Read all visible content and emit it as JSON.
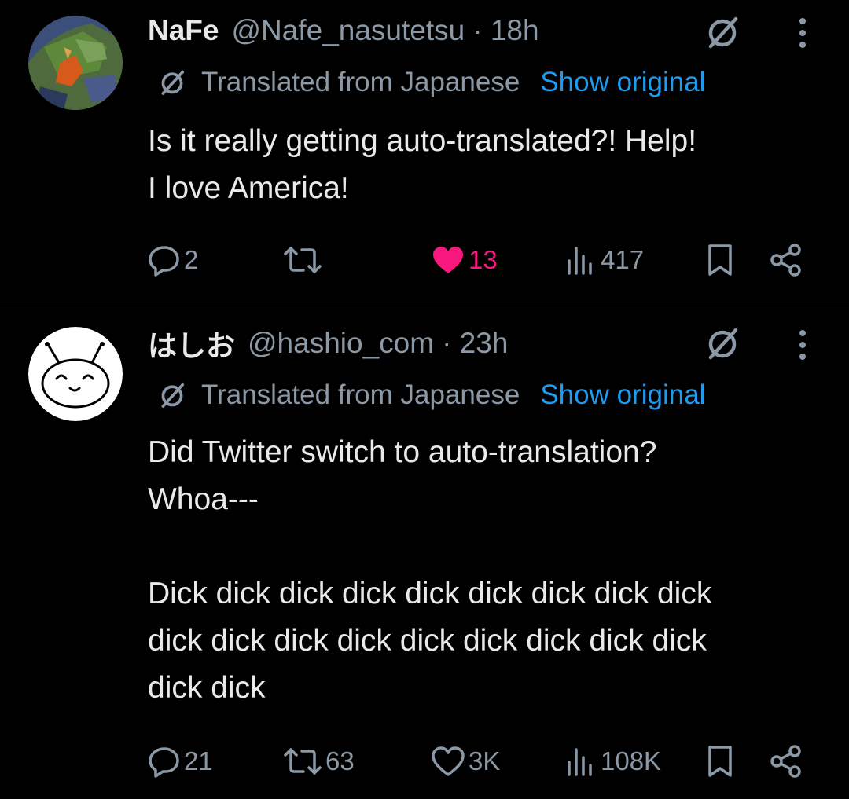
{
  "tweets": [
    {
      "name": "NaFe",
      "handle": "@Nafe_nasutetsu",
      "time": "· 18h",
      "translated_label": "Translated from Japanese",
      "show_original": "Show original",
      "text": "Is it really getting auto-translated?! Help!\nI love America!",
      "replies": "2",
      "retweets": "",
      "likes": "13",
      "liked": true,
      "views": "417",
      "icons": [
        "reply-icon",
        "retweet-icon",
        "heart-icon",
        "views-icon",
        "bookmark-icon",
        "share-icon"
      ]
    },
    {
      "name": "はしお",
      "handle": "@hashio_com",
      "time": "· 23h",
      "translated_label": "Translated from Japanese",
      "show_original": "Show original",
      "text": "Did Twitter switch to auto-translation?\nWhoa---\n\nDick dick dick dick dick dick dick dick dick\ndick dick dick dick dick dick dick dick dick\ndick dick",
      "replies": "21",
      "retweets": "63",
      "likes": "3K",
      "liked": false,
      "views": "108K"
    }
  ],
  "colors": {
    "background": "#000000",
    "text": "#e7e9ea",
    "muted": "#8b98a5",
    "link": "#1d9bf0",
    "like": "#f91880",
    "divider": "#2f3336"
  }
}
